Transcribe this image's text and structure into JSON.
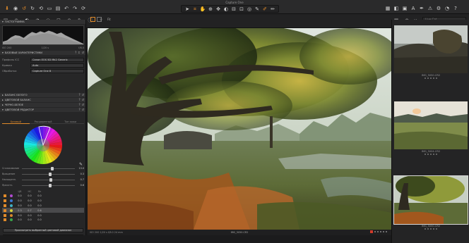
{
  "app": {
    "title": "Capture One"
  },
  "toolbar": {
    "left_icons": [
      "import-icon",
      "camera-icon",
      "undo-icon",
      "redo-icon",
      "rotate-icon",
      "folder-icon",
      "trash-icon",
      "back-icon",
      "forward-icon",
      "reset-icon"
    ],
    "center_icons": [
      "cursor-icon",
      "crop-icon",
      "hand-icon",
      "zoom-icon",
      "pan-icon",
      "rotate-tool-icon",
      "straighten-icon",
      "keystone-icon",
      "spot-icon",
      "picker-icon",
      "brush-icon",
      "annotate-icon"
    ],
    "right_icons": [
      "grid-icon",
      "compare-icon",
      "proof-icon",
      "text-icon",
      "pen-icon",
      "warning-icon",
      "settings-icon",
      "eye-icon",
      "help-icon"
    ]
  },
  "subbar": {
    "viewer_label": "Fit",
    "browser_count": "11",
    "browser_search_placeholder": "Live Cat"
  },
  "left_panel": {
    "histogram_header": "ГИСТОГРАММА",
    "histogram_meta": [
      "ISO 200",
      "1/20 s",
      "f/8.0"
    ],
    "base_header": "БАЗОВЫЕ ХАРАКТЕРИСТИКИ",
    "props": [
      {
        "label": "Профиль ICC",
        "value": "Canon EOS 5D Mk2 Generic"
      },
      {
        "label": "Кривая",
        "value": "Auto"
      },
      {
        "label": "Обработка",
        "value": "Capture One 8"
      }
    ],
    "sections": [
      "БАЛАНС БЕЛОГО",
      "ЦВЕТОВОЙ БАЛАНС",
      "ЧЕРНО-БЕЛОЕ",
      "ЦВЕТОВОЙ РЕДАКТОР"
    ],
    "cb_tabs": [
      "Базовый",
      "Расширенный",
      "Тон кожи"
    ],
    "sliders": [
      {
        "label": "Сглаживание",
        "value": "13.0",
        "pct": 0.55
      },
      {
        "label": "Вращение",
        "value": "0.3",
        "pct": 0.5
      },
      {
        "label": "Насыщенн.",
        "value": "0.7",
        "pct": 0.52
      },
      {
        "label": "Яркость",
        "value": "0.6",
        "pct": 0.51
      }
    ],
    "table_head": [
      "ЦВ",
      "НС",
      "Ял"
    ],
    "selections": [
      {
        "on": true,
        "color": "#b04bd0",
        "v": [
          "0.0",
          "0.0",
          "0.0"
        ],
        "active": false
      },
      {
        "on": true,
        "color": "#3d7ad6",
        "v": [
          "0.0",
          "0.0",
          "0.0"
        ],
        "active": false
      },
      {
        "on": true,
        "color": "#3fb2c6",
        "v": [
          "0.0",
          "0.0",
          "0.0"
        ],
        "active": false
      },
      {
        "on": true,
        "color": "#d6d23a",
        "v": [
          "0.3",
          "0.7",
          "0.6"
        ],
        "active": true
      },
      {
        "on": true,
        "color": "#d9892c",
        "v": [
          "0.0",
          "0.0",
          "0.0"
        ],
        "active": false
      },
      {
        "on": true,
        "color": "#39a64a",
        "v": [
          "0.0",
          "0.0",
          "0.0"
        ],
        "active": false
      }
    ],
    "show_range_button": "Просмотреть выбранный цветовой диапазон",
    "selected_color": "#a49a3a"
  },
  "viewer": {
    "meta": "ISO 200   1/20 s   f/8.0   24 mm",
    "filename": "IMG_5050.CR2"
  },
  "browser": {
    "thumbs": [
      {
        "name": "IMG_5050.CR2",
        "selected": false
      },
      {
        "name": "IMG_5004.CR2",
        "selected": false
      },
      {
        "name": "IMG_5050.CR2",
        "selected": true
      }
    ]
  }
}
